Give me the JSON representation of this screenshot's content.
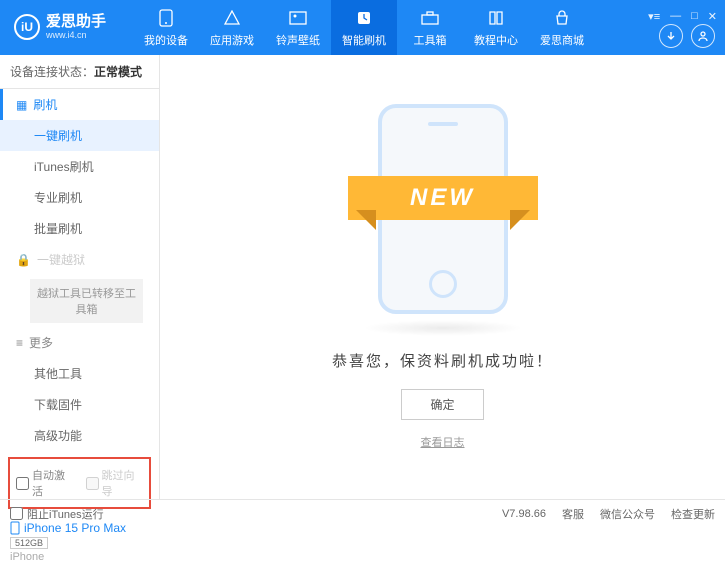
{
  "app": {
    "name": "爱思助手",
    "url": "www.i4.cn"
  },
  "topnav": {
    "items": [
      {
        "label": "我的设备"
      },
      {
        "label": "应用游戏"
      },
      {
        "label": "铃声壁纸"
      },
      {
        "label": "智能刷机"
      },
      {
        "label": "工具箱"
      },
      {
        "label": "教程中心"
      },
      {
        "label": "爱思商城"
      }
    ],
    "active_index": 3
  },
  "sidebar": {
    "conn_prefix": "设备连接状态：",
    "conn_value": "正常模式",
    "section_flash": "刷机",
    "items_flash": [
      "一键刷机",
      "iTunes刷机",
      "专业刷机",
      "批量刷机"
    ],
    "active_flash_index": 0,
    "section_jailbreak": "一键越狱",
    "jailbreak_note": "越狱工具已转移至工具箱",
    "section_more": "更多",
    "items_more": [
      "其他工具",
      "下载固件",
      "高级功能"
    ],
    "checks": {
      "auto_activate": "自动激活",
      "skip_guide": "跳过向导"
    },
    "device": {
      "name": "iPhone 15 Pro Max",
      "storage": "512GB",
      "model": "iPhone"
    }
  },
  "main": {
    "banner": "NEW",
    "success_msg": "恭喜您，保资料刷机成功啦！",
    "ok_label": "确定",
    "log_link": "查看日志"
  },
  "footer": {
    "block_itunes": "阻止iTunes运行",
    "version": "V7.98.66",
    "links": [
      "客服",
      "微信公众号",
      "检查更新"
    ]
  }
}
